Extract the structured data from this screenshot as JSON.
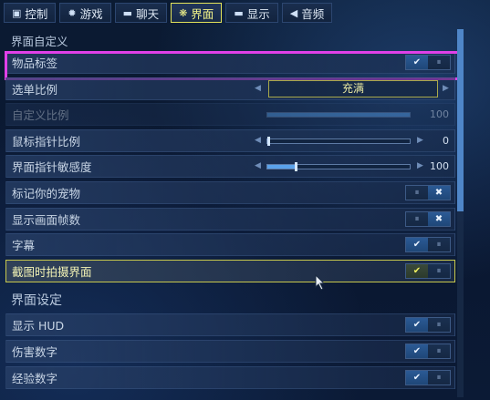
{
  "tabs": [
    {
      "label": "控制",
      "icon": "gamepad-icon",
      "glyph": "▣"
    },
    {
      "label": "游戏",
      "icon": "gear-icon",
      "glyph": "✹"
    },
    {
      "label": "聊天",
      "icon": "chat-icon",
      "glyph": "▬"
    },
    {
      "label": "界面",
      "icon": "interface-icon",
      "glyph": "❋",
      "active": true
    },
    {
      "label": "显示",
      "icon": "monitor-icon",
      "glyph": "▬"
    },
    {
      "label": "音频",
      "icon": "speaker-icon",
      "glyph": "◀"
    }
  ],
  "sections": {
    "custom": "界面自定义",
    "settings": "界面设定"
  },
  "rows": {
    "item_labels": {
      "label": "物品标签",
      "state": "on"
    },
    "menu_scale": {
      "label": "选单比例",
      "value": "充满"
    },
    "custom_scale": {
      "label": "自定义比例",
      "value": "100",
      "fill": 1.0
    },
    "pointer_scale": {
      "label": "鼠标指针比例",
      "value": "0",
      "fill": 0.0
    },
    "pointer_sens": {
      "label": "界面指针敏感度",
      "value": "100",
      "fill": 0.2
    },
    "mark_pets": {
      "label": "标记你的宠物",
      "state": "off"
    },
    "show_fps": {
      "label": "显示画面帧数",
      "state": "off"
    },
    "subtitles": {
      "label": "字幕",
      "state": "on"
    },
    "screenshot_ui": {
      "label": "截图时拍摄界面",
      "state": "on"
    },
    "show_hud": {
      "label": "显示 HUD",
      "state": "on"
    },
    "damage_numbers": {
      "label": "伤害数字",
      "state": "on"
    },
    "exp_numbers": {
      "label": "经验数字",
      "state": "on"
    }
  },
  "glyphs": {
    "check": "✔",
    "pause": "⏸",
    "cross": "✖",
    "arrow_left": "◀",
    "arrow_right": "▶"
  },
  "colors": {
    "accent": "#e3e35a",
    "selection": "#e040e8",
    "toggle_on": "#2b5a95"
  }
}
